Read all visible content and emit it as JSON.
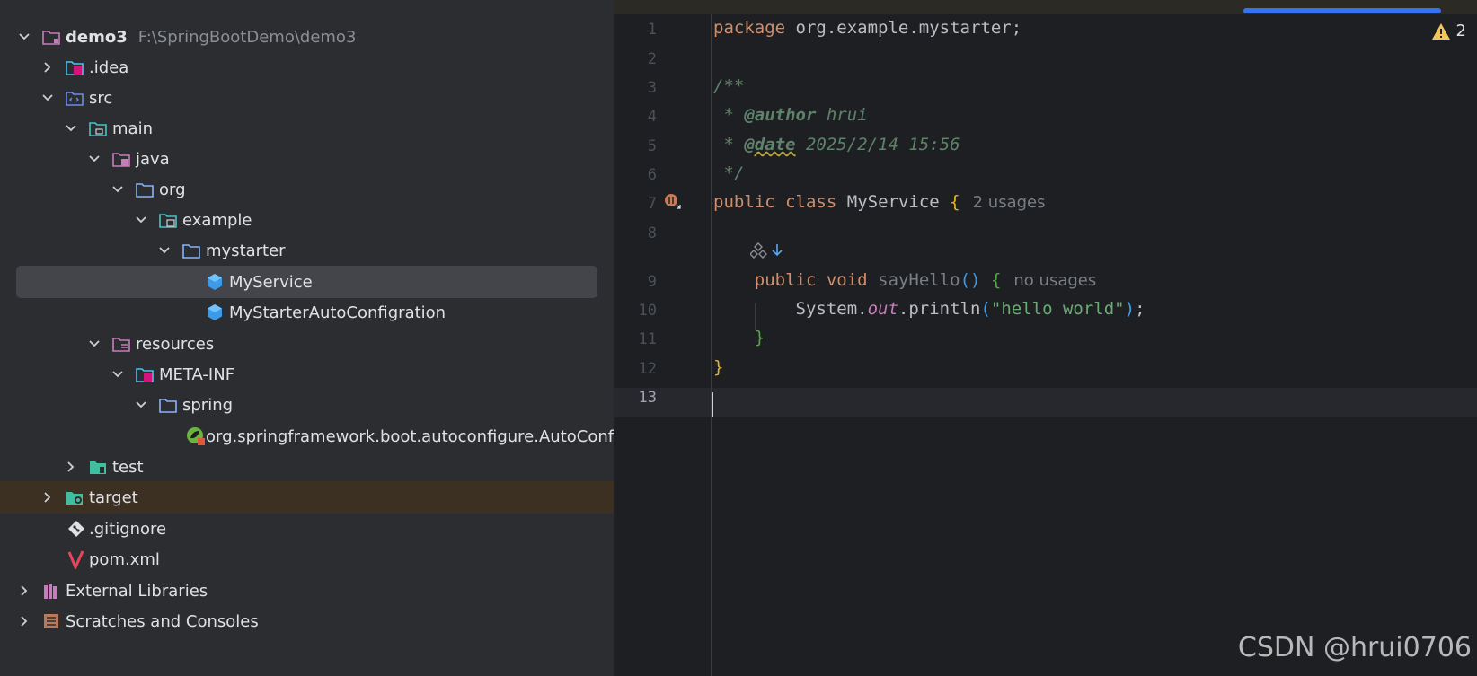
{
  "project_tree": {
    "items": [
      {
        "label": "demo3",
        "path_hint": "F:\\SpringBootDemo\\demo3",
        "icon": "module-folder-icon",
        "expanded": true
      },
      {
        "label": ".idea",
        "icon": "idea-folder-icon",
        "expanded": false
      },
      {
        "label": "src",
        "icon": "source-folder-icon",
        "expanded": true
      },
      {
        "label": "main",
        "icon": "folder-icon",
        "expanded": true
      },
      {
        "label": "java",
        "icon": "java-source-root-icon",
        "expanded": true
      },
      {
        "label": "org",
        "icon": "package-folder-icon",
        "expanded": true
      },
      {
        "label": "example",
        "icon": "package-folder-icon",
        "expanded": true
      },
      {
        "label": "mystarter",
        "icon": "package-folder-icon",
        "expanded": true
      },
      {
        "label": "MyService",
        "icon": "java-class-icon",
        "selected": true
      },
      {
        "label": "MyStarterAutoConfigration",
        "icon": "java-class-icon"
      },
      {
        "label": "resources",
        "icon": "resources-root-icon",
        "expanded": true
      },
      {
        "label": "META-INF",
        "icon": "meta-inf-folder-icon",
        "expanded": true
      },
      {
        "label": "spring",
        "icon": "folder-icon",
        "expanded": true
      },
      {
        "label": "org.springframework.boot.autoconfigure.AutoConfiguration.imports",
        "icon": "spring-file-icon"
      },
      {
        "label": "test",
        "icon": "test-folder-icon",
        "expanded": false
      },
      {
        "label": "target",
        "icon": "target-folder-icon",
        "expanded": false
      },
      {
        "label": ".gitignore",
        "icon": "git-icon"
      },
      {
        "label": "pom.xml",
        "icon": "maven-icon"
      },
      {
        "label": "External Libraries",
        "icon": "libraries-icon",
        "expanded": false
      },
      {
        "label": "Scratches and Consoles",
        "icon": "scratches-icon",
        "expanded": false
      }
    ]
  },
  "editor": {
    "warning_count": "2",
    "active_line": "13",
    "lines": [
      {
        "num": "1",
        "package_kw": "package",
        "package_name": "org.example.mystarter;"
      },
      {
        "num": "2"
      },
      {
        "num": "3",
        "text": "/**"
      },
      {
        "num": "4",
        "prefix": " * ",
        "tag": "@author",
        "value": "hrui"
      },
      {
        "num": "5",
        "prefix": " * ",
        "tag": "@date",
        "value": "2025/2/14 15:56"
      },
      {
        "num": "6",
        "text": " */"
      },
      {
        "num": "7",
        "kw1": "public",
        "kw2": "class",
        "name": "MyService",
        "brace": "{",
        "hint": "2 usages"
      },
      {
        "num": "8"
      },
      {
        "num": "9",
        "kw1": "public",
        "kw2": "void",
        "method": "sayHello",
        "parens": "()",
        "brace": "{",
        "hint": "no usages"
      },
      {
        "num": "10",
        "obj": "System.",
        "field": "out",
        "call": ".println",
        "open": "(",
        "str": "\"hello world\"",
        "close": ")",
        "semi": ";"
      },
      {
        "num": "11",
        "brace": "}"
      },
      {
        "num": "12",
        "brace": "}"
      },
      {
        "num": "13"
      }
    ]
  },
  "watermark": "CSDN @hrui0706"
}
